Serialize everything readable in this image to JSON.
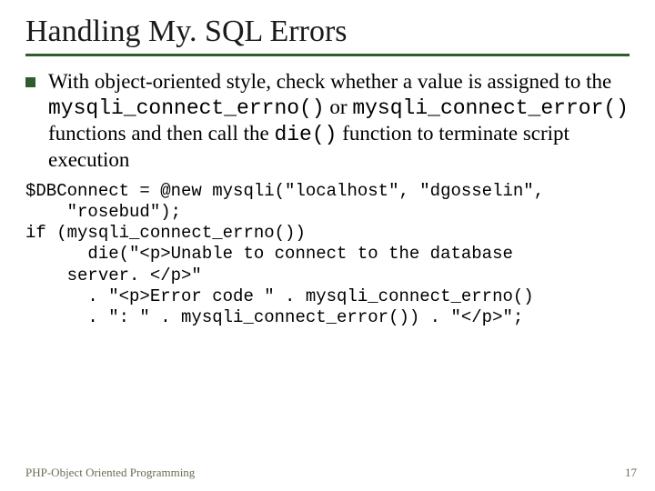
{
  "title": "Handling My. SQL Errors",
  "bullet": {
    "pre": "With object-oriented style, check whether a value is assigned to the ",
    "fn1": "mysqli_connect_errno()",
    "mid1": " or ",
    "fn2": "mysqli_connect_error()",
    "mid2": " functions and then call the ",
    "fn3": "die()",
    "post": " function to terminate script execution"
  },
  "code": "$DBConnect = @new mysqli(\"localhost\", \"dgosselin\",\n    \"rosebud\");\nif (mysqli_connect_errno())\n      die(\"<p>Unable to connect to the database\n    server. </p>\"\n      . \"<p>Error code \" . mysqli_connect_errno()\n      . \": \" . mysqli_connect_error()) . \"</p>\";",
  "footer_left": "PHP-Object Oriented Programming",
  "footer_right": "17"
}
